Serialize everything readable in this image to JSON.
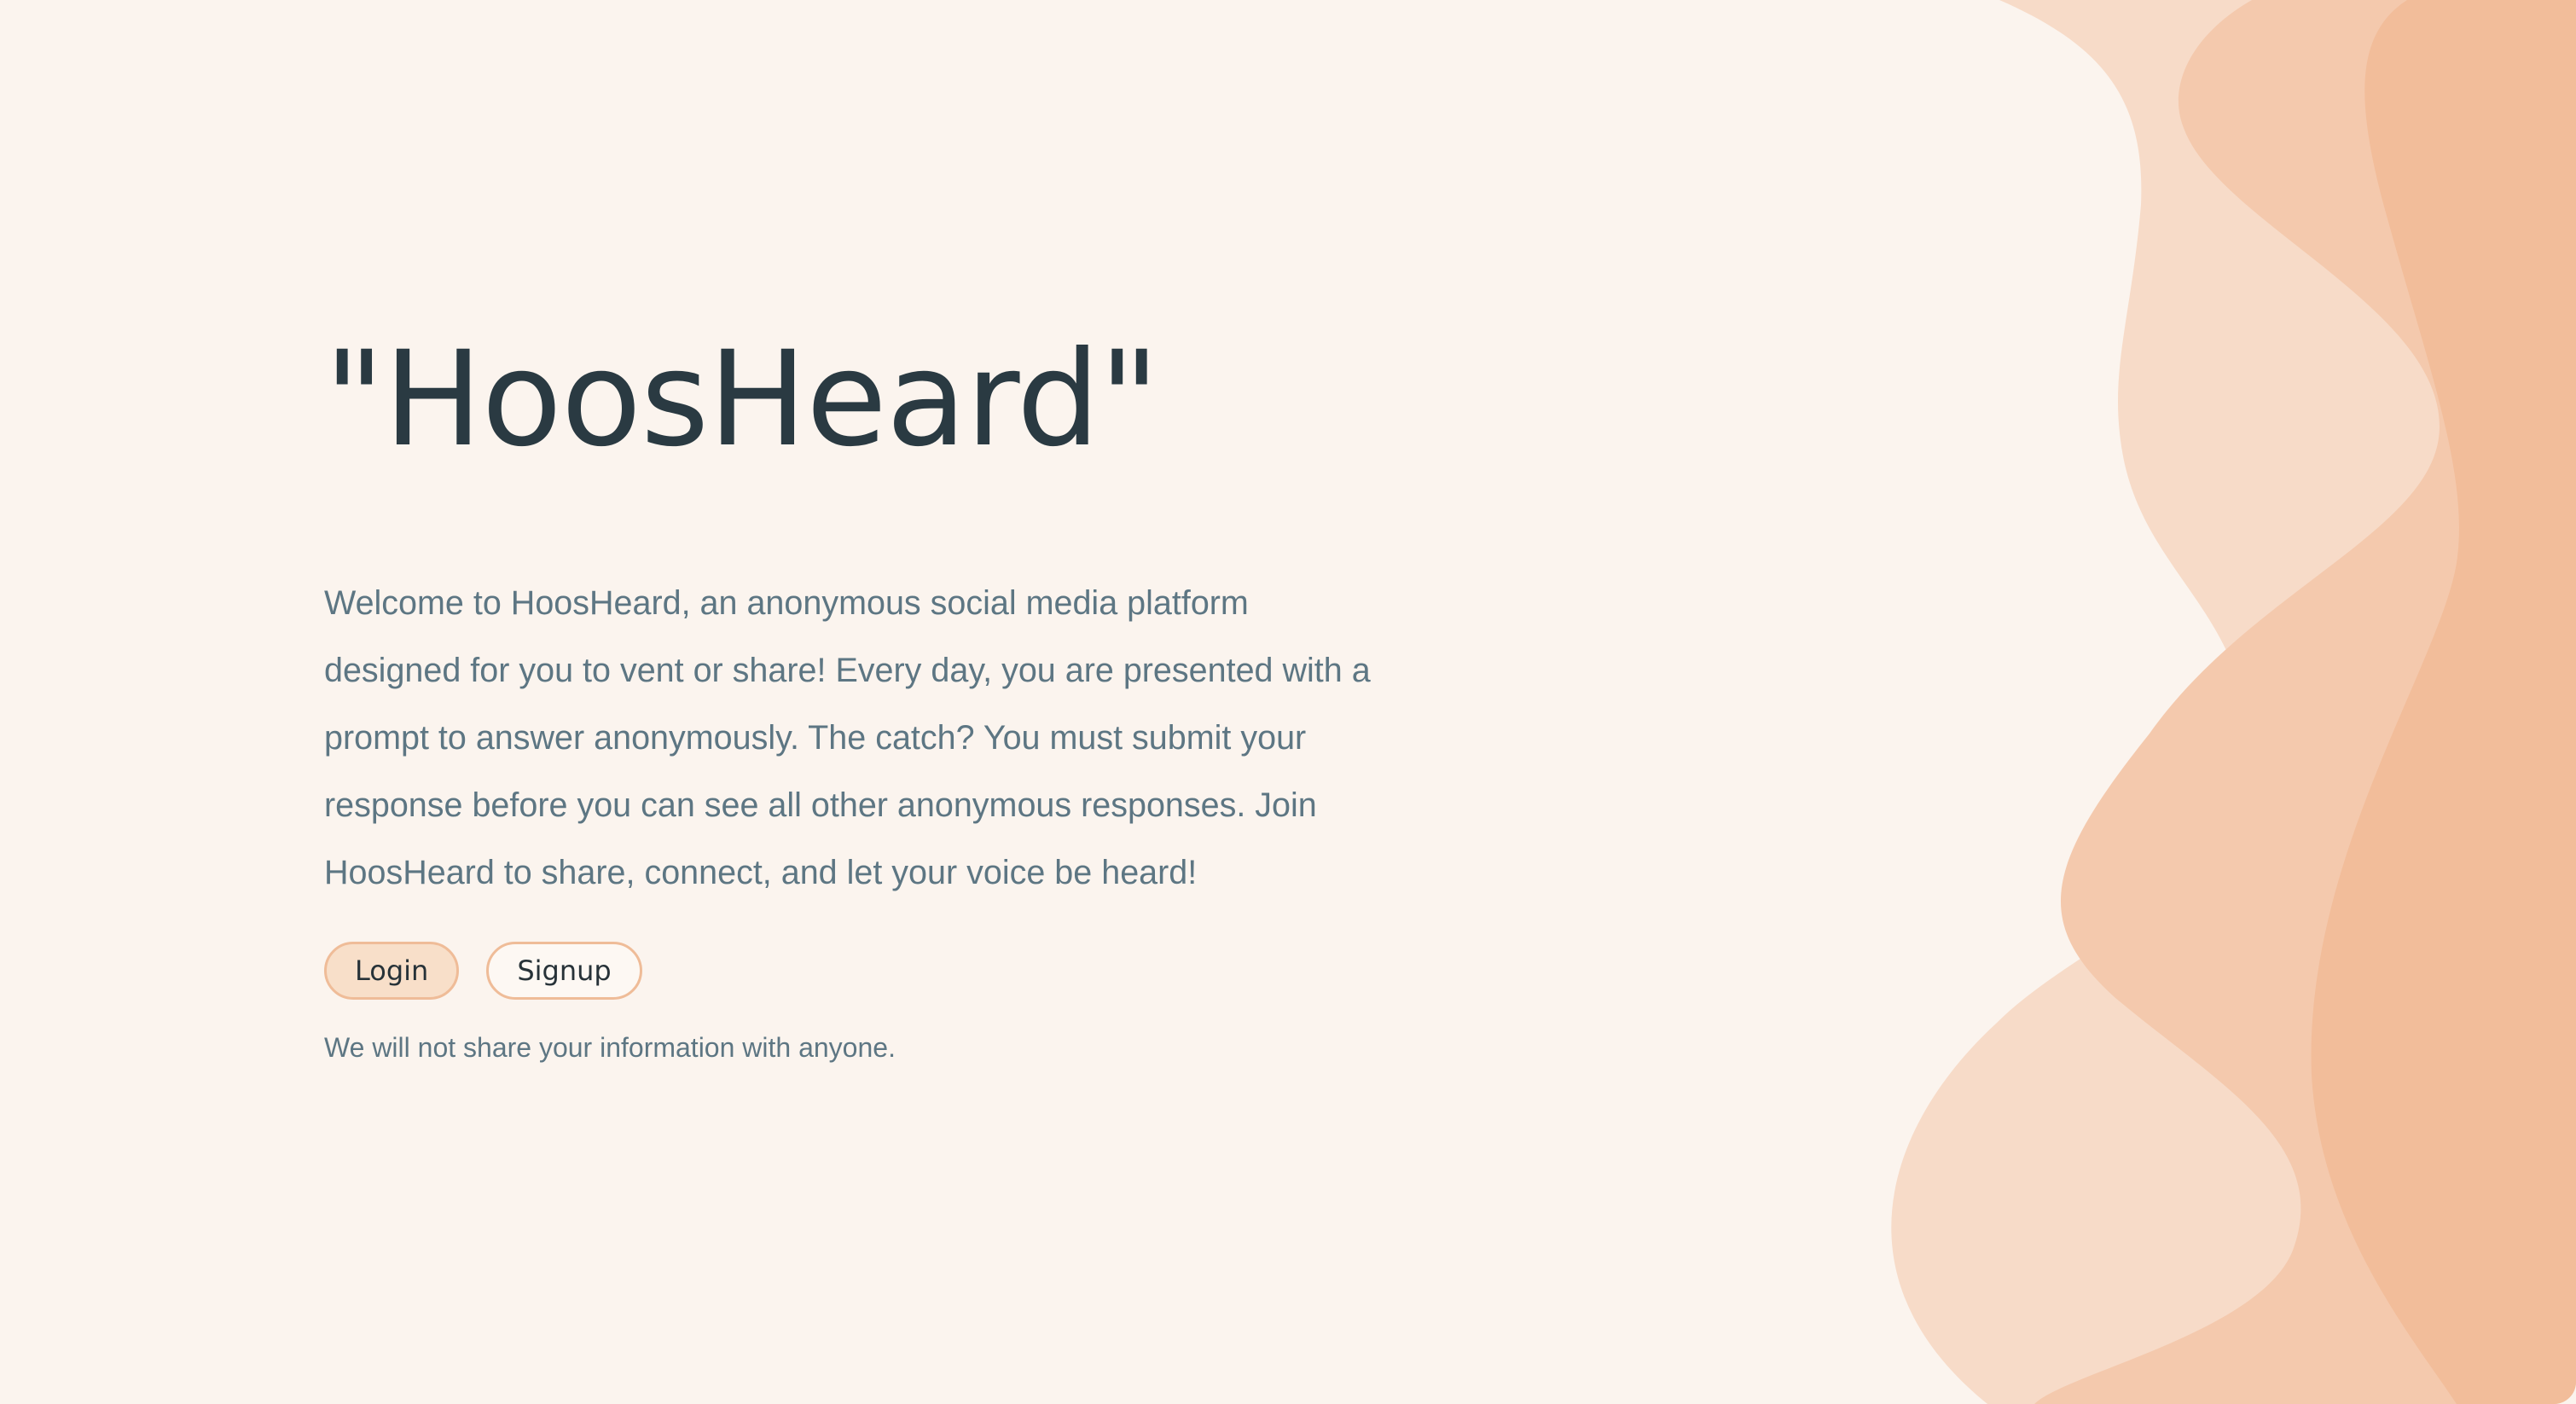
{
  "hero": {
    "title": "\"HoosHeard\"",
    "intro": "Welcome to HoosHeard, an anonymous social media platform designed for you to vent or share! Every day, you are presented with a prompt to answer anonymously. The catch? You must submit your response before you can see all other anonymous responses. Join HoosHeard to share, connect, and let your voice be heard!",
    "disclaimer": "We will not share your information with anyone."
  },
  "actions": {
    "login_label": "Login",
    "signup_label": "Signup"
  },
  "colors": {
    "background": "#fbf4ee",
    "title_text": "#2a3a42",
    "body_text": "#5d7683",
    "wave_light": "#f7dbc8",
    "wave_mid": "#f4c9ad",
    "wave_dark": "#f2bd9a",
    "button_border": "#efbc98",
    "login_fill": "#f8dfc9"
  }
}
